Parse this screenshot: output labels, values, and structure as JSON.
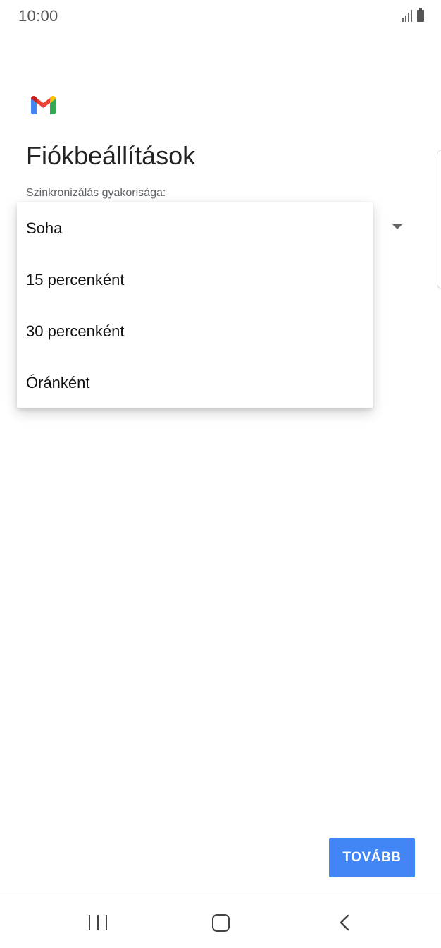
{
  "status_bar": {
    "time": "10:00",
    "icons": [
      "signal-icon",
      "battery-icon"
    ]
  },
  "app": {
    "logo": "gmail-logo",
    "colors": {
      "red": "#EA4335",
      "blue": "#4285F4",
      "green": "#34A853",
      "yellow": "#FBBC04"
    }
  },
  "main": {
    "title": "Fiókbeállítások",
    "sync_label": "Szinkronizálás gyakorisága:",
    "sync_dropdown_icon": "dropdown-arrow-icon"
  },
  "dropdown": {
    "options": [
      {
        "label": "Soha"
      },
      {
        "label": "15 percenként"
      },
      {
        "label": "30 percenként"
      },
      {
        "label": "Óránként"
      }
    ]
  },
  "footer": {
    "next_label": "TOVÁBB",
    "next_color": "#4285F4"
  },
  "navigation": {
    "icons": [
      "recent-apps-icon",
      "home-icon",
      "back-icon"
    ]
  }
}
